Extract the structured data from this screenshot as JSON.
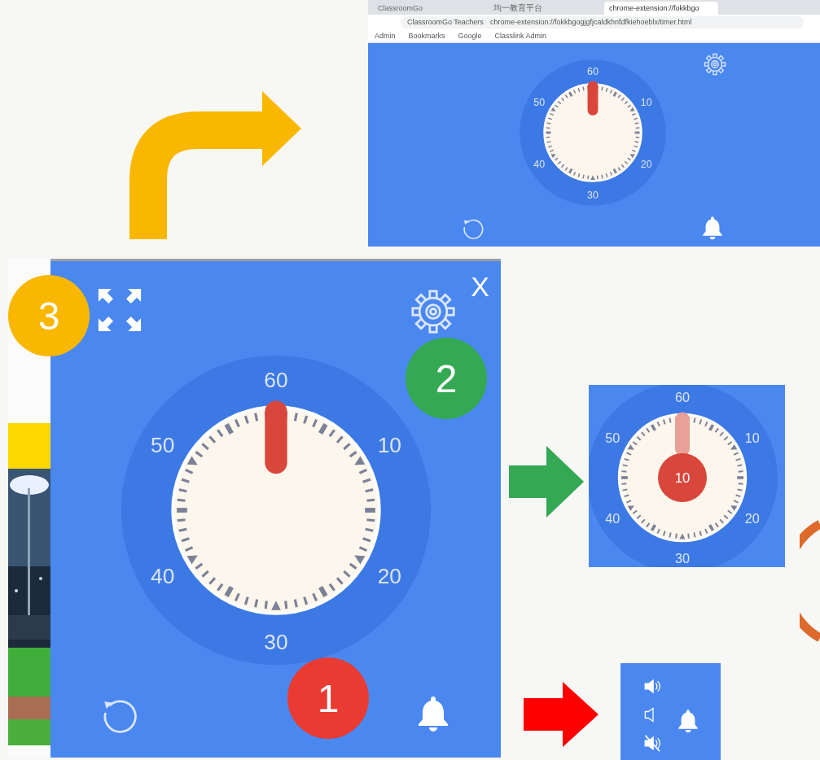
{
  "browser": {
    "tabs": [
      {
        "title": "ClassroomGo",
        "selected": false
      },
      {
        "title": "均一教育平台",
        "selected": false
      },
      {
        "title": "chrome-extension://fokkbgo",
        "selected": true
      }
    ],
    "address": {
      "site": "ClassroomGo Teachers",
      "url": "chrome-extension://fokkbgogjgfjcaldkhnfdfkiehoeblx/timer.html"
    },
    "bookmarks": [
      "Admin",
      "Bookmarks",
      "Google",
      "Classlink Admin"
    ],
    "timer": {
      "numbers": [
        "60",
        "10",
        "20",
        "30",
        "40",
        "50"
      ]
    }
  },
  "main_timer": {
    "close": "X",
    "numbers": [
      "60",
      "10",
      "20",
      "30",
      "40",
      "50"
    ]
  },
  "badges": [
    {
      "label": "3",
      "color": "#f9b700"
    },
    {
      "label": "2",
      "color": "#34a853"
    },
    {
      "label": "1",
      "color": "#ea3b33"
    }
  ],
  "settings_preview": {
    "numbers": [
      "60",
      "10",
      "20",
      "30",
      "40",
      "50"
    ],
    "knob": "10"
  },
  "sound_preview": {
    "options": [
      {
        "kind": "loud"
      },
      {
        "kind": "soft"
      },
      {
        "kind": "muted"
      }
    ]
  }
}
